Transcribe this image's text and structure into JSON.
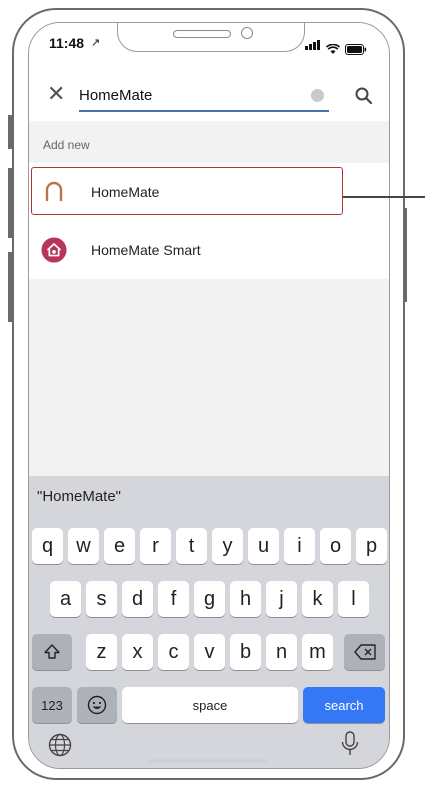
{
  "status_bar": {
    "time": "11:48"
  },
  "search": {
    "query": "HomeMate"
  },
  "results": {
    "section_label": "Add new",
    "items": [
      {
        "label": "HomeMate",
        "icon": "homemate-arch-icon",
        "highlighted": true
      },
      {
        "label": "HomeMate Smart",
        "icon": "homemate-smart-house-icon",
        "highlighted": false
      }
    ]
  },
  "keyboard": {
    "prediction": "\"HomeMate\"",
    "row1": [
      "q",
      "w",
      "e",
      "r",
      "t",
      "y",
      "u",
      "i",
      "o",
      "p"
    ],
    "row2": [
      "a",
      "s",
      "d",
      "f",
      "g",
      "h",
      "j",
      "k",
      "l"
    ],
    "row3": [
      "z",
      "x",
      "c",
      "v",
      "b",
      "n",
      "m"
    ],
    "numbers_label": "123",
    "space_label": "space",
    "search_label": "search"
  },
  "colors": {
    "highlight": "#b4333b",
    "accent": "#3478f6",
    "smart_icon": "#b8345a",
    "arch_icon": "#c0714a"
  }
}
